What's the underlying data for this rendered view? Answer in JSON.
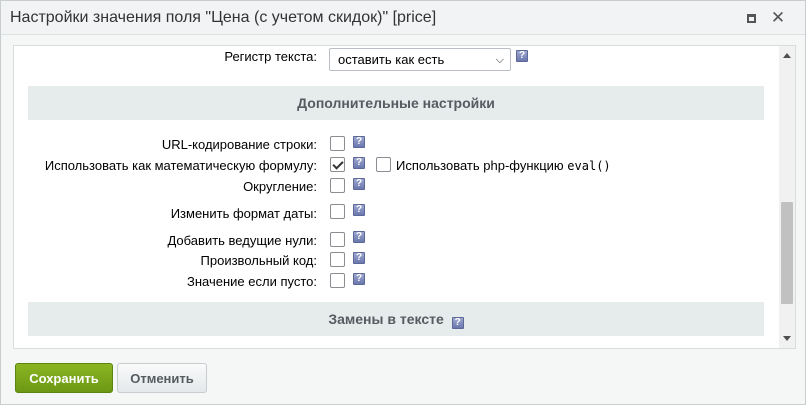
{
  "dialog": {
    "title": "Настройки значения поля \"Цена (с учетом скидок)\" [price]",
    "maximize_icon": "maximize-icon",
    "close_symbol": "✕"
  },
  "text_case": {
    "label": "Регистр текста:",
    "selected": "оставить как есть"
  },
  "section_additional": {
    "title": "Дополнительные настройки"
  },
  "options": {
    "url_encode": {
      "label": "URL-кодирование строки:",
      "checked": false
    },
    "math_formula": {
      "label": "Использовать как математическую формулу:",
      "checked": true
    },
    "php_eval": {
      "label_prefix": "Использовать php-функцию",
      "code": "eval()",
      "checked": false
    },
    "rounding": {
      "label": "Округление:",
      "checked": false
    },
    "date_format": {
      "label": "Изменить формат даты:",
      "checked": false
    },
    "leading_zeros": {
      "label": "Добавить ведущие нули:",
      "checked": false
    },
    "custom_code": {
      "label": "Произвольный код:",
      "checked": false
    },
    "if_empty": {
      "label": "Значение если пусто:",
      "checked": false
    }
  },
  "section_replacements": {
    "title": "Замены в тексте"
  },
  "help_glyph": "?",
  "footer": {
    "save_label": "Сохранить",
    "cancel_label": "Отменить"
  },
  "colors": {
    "save_button": "#76a319",
    "section_header": "#e6ebec",
    "help_icon": "#7c88bd"
  }
}
